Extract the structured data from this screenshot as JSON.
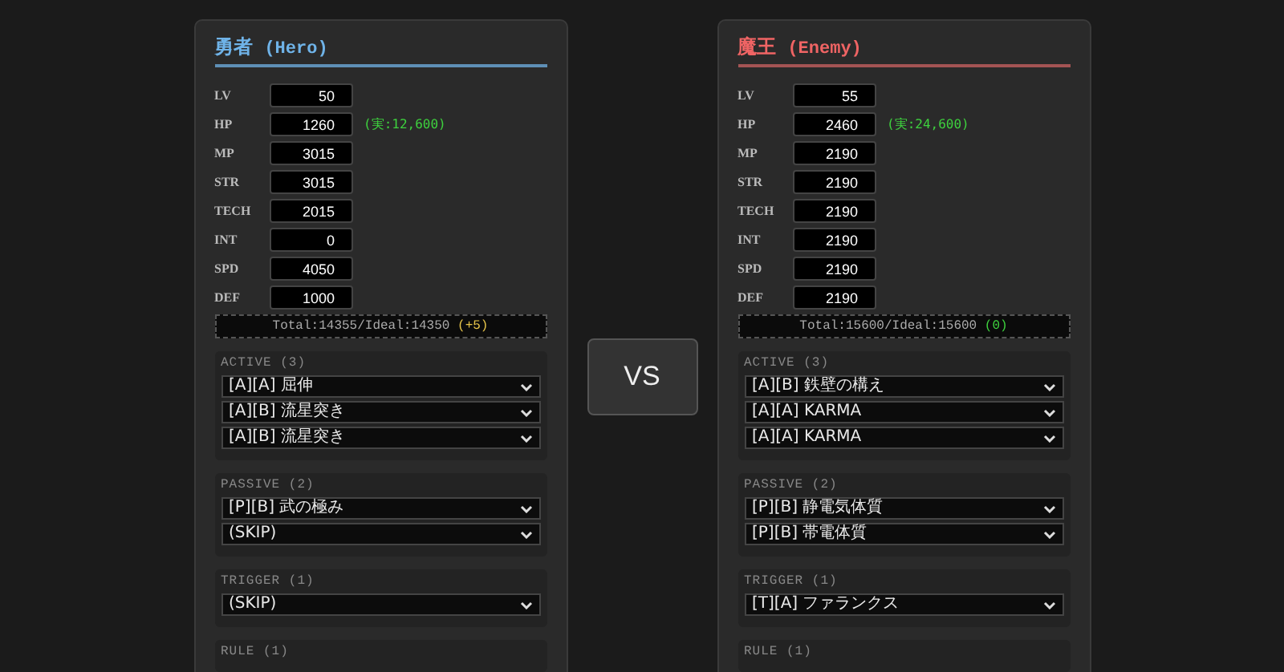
{
  "vs_label": "VS",
  "sides": [
    {
      "kind": "hero",
      "name": "勇者",
      "tag": "(Hero)",
      "stats": [
        {
          "label": "LV",
          "value": "50"
        },
        {
          "label": "HP",
          "value": "1260",
          "note": "(実:12,600)"
        },
        {
          "label": "MP",
          "value": "3015"
        },
        {
          "label": "STR",
          "value": "3015"
        },
        {
          "label": "TECH",
          "value": "2015"
        },
        {
          "label": "INT",
          "value": "0"
        },
        {
          "label": "SPD",
          "value": "4050"
        },
        {
          "label": "DEF",
          "value": "1000"
        }
      ],
      "total": "Total:14355/Ideal:14350",
      "diff": {
        "text": "(+5)",
        "color": "#e6c44a"
      },
      "groups": [
        {
          "title": "ACTIVE (3)",
          "selects": [
            "[A][A] 屈伸",
            "[A][B] 流星突き",
            "[A][B] 流星突き"
          ]
        },
        {
          "title": "PASSIVE (2)",
          "selects": [
            "[P][B] 武の極み",
            "(SKIP)"
          ]
        },
        {
          "title": "TRIGGER (1)",
          "selects": [
            "(SKIP)"
          ]
        },
        {
          "title": "RULE (1)"
        }
      ]
    },
    {
      "kind": "enemy",
      "name": "魔王",
      "tag": "(Enemy)",
      "stats": [
        {
          "label": "LV",
          "value": "55"
        },
        {
          "label": "HP",
          "value": "2460",
          "note": "(実:24,600)"
        },
        {
          "label": "MP",
          "value": "2190"
        },
        {
          "label": "STR",
          "value": "2190"
        },
        {
          "label": "TECH",
          "value": "2190"
        },
        {
          "label": "INT",
          "value": "2190"
        },
        {
          "label": "SPD",
          "value": "2190"
        },
        {
          "label": "DEF",
          "value": "2190"
        }
      ],
      "total": "Total:15600/Ideal:15600",
      "diff": {
        "text": "(0)",
        "color": "#3ed13e"
      },
      "groups": [
        {
          "title": "ACTIVE (3)",
          "selects": [
            "[A][B] 鉄壁の構え",
            "[A][A] KARMA",
            "[A][A] KARMA"
          ]
        },
        {
          "title": "PASSIVE (2)",
          "selects": [
            "[P][B] 静電気体質",
            "[P][B] 帯電体質"
          ]
        },
        {
          "title": "TRIGGER (1)",
          "selects": [
            "[T][A] ファランクス"
          ]
        },
        {
          "title": "RULE (1)"
        }
      ]
    }
  ]
}
